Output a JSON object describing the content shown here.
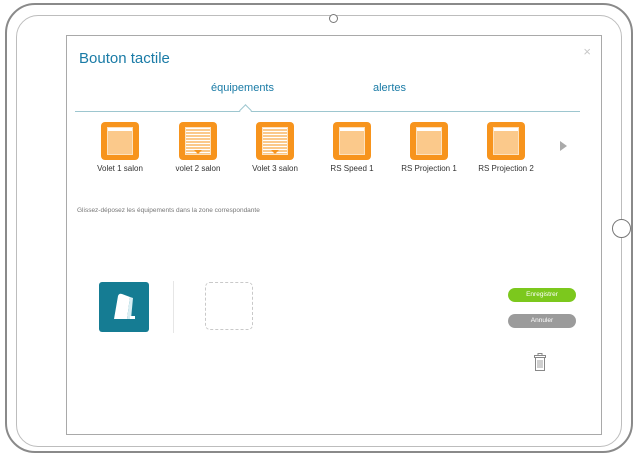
{
  "dialog": {
    "title": "Bouton tactile",
    "close_glyph": "×"
  },
  "tabs": [
    {
      "label": "équipements",
      "active": true
    },
    {
      "label": "alertes",
      "active": false
    }
  ],
  "devices": [
    {
      "label": "Volet 1 salon",
      "icon": "shutter-open-icon"
    },
    {
      "label": "volet 2 salon",
      "icon": "shutter-closed-icon"
    },
    {
      "label": "Volet 3 salon",
      "icon": "shutter-closed-icon"
    },
    {
      "label": "RS Speed 1",
      "icon": "shutter-open-icon"
    },
    {
      "label": "RS Projection 1",
      "icon": "shutter-open-icon"
    },
    {
      "label": "RS Projection 2",
      "icon": "shutter-open-icon"
    }
  ],
  "hint": "Glissez-déposez les équipements dans la zone correspondante",
  "actions": {
    "save_label": "Enregistrer",
    "cancel_label": "Annuler"
  },
  "colors": {
    "accent": "#1a7ba6",
    "device_orange": "#f7941d",
    "switch_teal": "#157c93",
    "save_green": "#7cc81d",
    "cancel_grey": "#9b9b9b"
  }
}
